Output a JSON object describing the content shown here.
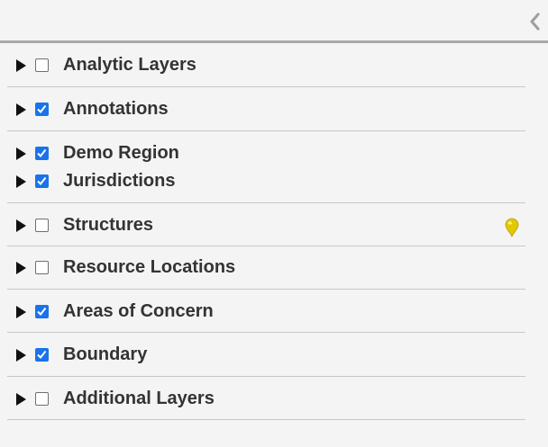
{
  "panel": {
    "collapse_icon": "chevron-left-icon",
    "accent_color": "#1a73e8",
    "marker_color": "#e8d10a"
  },
  "groups": [
    {
      "layers": [
        {
          "label": "Analytic Layers",
          "checked": false
        }
      ]
    },
    {
      "layers": [
        {
          "label": "Annotations",
          "checked": true
        }
      ]
    },
    {
      "layers": [
        {
          "label": "Demo Region",
          "checked": true
        },
        {
          "label": "Jurisdictions",
          "checked": true
        }
      ]
    },
    {
      "layers": [
        {
          "label": "Structures",
          "checked": false,
          "icon": "map-marker-icon"
        }
      ]
    },
    {
      "layers": [
        {
          "label": "Resource Locations",
          "checked": false
        }
      ]
    },
    {
      "layers": [
        {
          "label": "Areas of Concern",
          "checked": true
        }
      ]
    },
    {
      "layers": [
        {
          "label": "Boundary",
          "checked": true
        }
      ]
    },
    {
      "layers": [
        {
          "label": "Additional Layers",
          "checked": false
        }
      ]
    }
  ]
}
